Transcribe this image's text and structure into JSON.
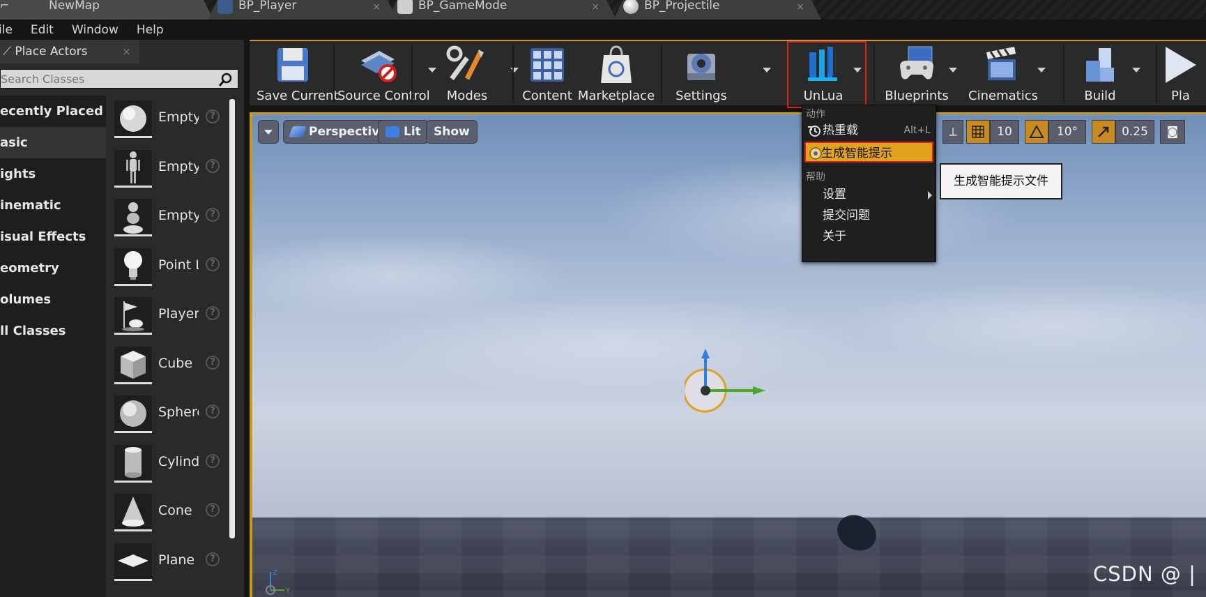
{
  "tabs": [
    {
      "label": "NewMap"
    },
    {
      "label": "BP_Player"
    },
    {
      "label": "BP_GameMode"
    },
    {
      "label": "BP_Projectile"
    }
  ],
  "menubar": [
    "ile",
    "Edit",
    "Window",
    "Help"
  ],
  "place_actors": {
    "title": "Place Actors",
    "close": "×",
    "search_placeholder": "Search Classes",
    "categories": [
      "ecently Placed",
      "asic",
      "ights",
      "inematic",
      "isual Effects",
      "eometry",
      "olumes",
      "ll Classes"
    ],
    "selected_category": "asic",
    "actors": [
      "Empty",
      "Empty",
      "Empty",
      "Point L",
      "Player",
      "Cube",
      "Sphere",
      "Cylinde",
      "Cone",
      "Plane"
    ],
    "help_glyph": "?"
  },
  "toolbar": {
    "buttons": [
      {
        "label": "Save Current",
        "icon": "floppy-disk-icon"
      },
      {
        "label": "Source Control",
        "icon": "source-control-icon"
      },
      {
        "label": "Modes",
        "icon": "modes-tools-icon"
      },
      {
        "label": "Content",
        "icon": "content-grid-icon"
      },
      {
        "label": "Marketplace",
        "icon": "marketplace-bag-icon"
      },
      {
        "label": "Settings",
        "icon": "settings-gear-icon"
      },
      {
        "label": "UnLua",
        "icon": "unlua-logo-icon"
      },
      {
        "label": "Blueprints",
        "icon": "blueprints-gamepad-icon"
      },
      {
        "label": "Cinematics",
        "icon": "cinematics-clapper-icon"
      },
      {
        "label": "Build",
        "icon": "build-blocks-icon"
      },
      {
        "label": "Pla",
        "icon": "play-icon"
      }
    ]
  },
  "viewport": {
    "view_mode": "Perspective",
    "lighting": "Lit",
    "show": "Show",
    "grid_snap": "10",
    "rotation_snap": "10°",
    "scale_snap": "0.25",
    "axis_y": "Y",
    "axis_z": "Z"
  },
  "unlua_menu": {
    "section_actions": "动作",
    "hot_reload": "热重载",
    "hot_reload_shortcut": "Alt+L",
    "generate_hints": "生成智能提示",
    "section_help": "帮助",
    "settings": "设置",
    "submit_issue": "提交问题",
    "about": "关于"
  },
  "tooltip": "生成智能提示文件",
  "watermark": "CSDN @ |",
  "colors": {
    "accent_gold": "#c89b20",
    "menu_highlight": "#e1a31c",
    "annotation_red": "#e02020"
  }
}
